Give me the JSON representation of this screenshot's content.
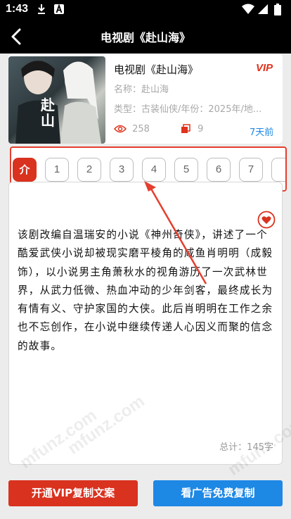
{
  "status_bar": {
    "time": "1:43"
  },
  "header": {
    "title": "电视剧《赴山海》"
  },
  "drama": {
    "title": "电视剧《赴山海》",
    "vip_badge": "VIP",
    "alias": "名称：赴山海",
    "meta": "类型：古装仙侠/年份：2025年/地...",
    "poster_title": "赴山",
    "views": "258",
    "copies": "9",
    "updated": "7天前"
  },
  "episodes": [
    "介",
    "1",
    "2",
    "3",
    "4",
    "5",
    "6",
    "7",
    ""
  ],
  "description": {
    "text": "该剧改编自温瑞安的小说《神州奇侠》，讲述了一个酷爱武侠小说却被现实磨平棱角的咸鱼肖明明（成毅 饰），以小说男主角萧秋水的视角游历了一次武林世界，从武力低微、热血冲动的少年剑客，最终成长为有情有义、守护家国的大侠。此后肖明明在工作之余也不忘创作，在小说中继续传递人心因义而聚的信念的故事。",
    "word_count": "总计：145字"
  },
  "actions": {
    "vip_copy": "开通VIP复制文案",
    "ad_copy": "看广告免费复制"
  },
  "watermark": "mfunz.com",
  "colors": {
    "accent_red": "#d9321f",
    "accent_blue": "#1e88e5"
  },
  "icons": [
    "download-icon",
    "a-icon",
    "wifi-icon",
    "signal-icon",
    "battery-icon",
    "back-icon",
    "eye-icon",
    "copy-icon",
    "heart-icon"
  ]
}
